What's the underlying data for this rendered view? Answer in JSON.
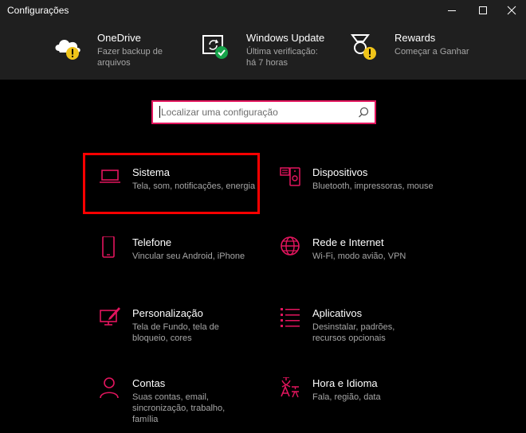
{
  "window": {
    "title": "Configurações"
  },
  "header": {
    "items": [
      {
        "title": "OneDrive",
        "subtitle": "Fazer backup de arquivos",
        "icon": "onedrive-warning-icon"
      },
      {
        "title": "Windows Update",
        "subtitle": "Última verificação: há 7 horas",
        "icon": "windows-update-ok-icon"
      },
      {
        "title": "Rewards",
        "subtitle": "Começar a Ganhar",
        "icon": "rewards-warning-icon"
      }
    ]
  },
  "search": {
    "placeholder": "Localizar uma configuração",
    "icon": "search-icon"
  },
  "tiles": [
    {
      "title": "Sistema",
      "subtitle": "Tela, som, notificações, energia",
      "icon": "laptop-icon"
    },
    {
      "title": "Dispositivos",
      "subtitle": "Bluetooth, impressoras, mouse",
      "icon": "devices-icon"
    },
    {
      "title": "Telefone",
      "subtitle": "Vincular seu Android, iPhone",
      "icon": "phone-icon"
    },
    {
      "title": "Rede e Internet",
      "subtitle": "Wi-Fi, modo avião, VPN",
      "icon": "globe-icon"
    },
    {
      "title": "Personalização",
      "subtitle": "Tela de Fundo, tela de bloqueio, cores",
      "icon": "personalization-icon"
    },
    {
      "title": "Aplicativos",
      "subtitle": "Desinstalar, padrões, recursos opcionais",
      "icon": "apps-list-icon"
    },
    {
      "title": "Contas",
      "subtitle": "Suas contas, email, sincronização, trabalho, família",
      "icon": "person-icon"
    },
    {
      "title": "Hora e Idioma",
      "subtitle": "Fala, região, data",
      "icon": "time-language-icon"
    }
  ],
  "colors": {
    "accent": "#e3155e",
    "highlight": "#ff0000",
    "warning": "#f0c419",
    "success": "#16a34a"
  }
}
